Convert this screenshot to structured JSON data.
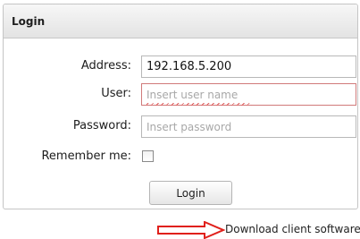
{
  "panel": {
    "title": "Login"
  },
  "form": {
    "address_label": "Address:",
    "address_value": "192.168.5.200",
    "user_label": "User:",
    "user_placeholder": "Insert user name",
    "password_label": "Password:",
    "password_placeholder": "Insert password",
    "remember_label": "Remember me:",
    "remember_checked": false,
    "login_label": "Login"
  },
  "footer": {
    "download_label": "Download client software"
  },
  "colors": {
    "arrow": "#e0201b",
    "invalid_border": "#d07a7a"
  },
  "icons": {
    "arrow": "right-arrow-icon"
  }
}
